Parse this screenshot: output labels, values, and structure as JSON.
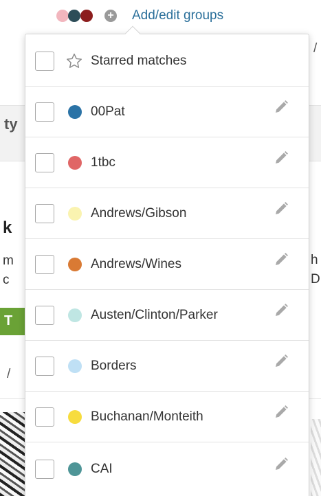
{
  "header": {
    "selected_group_colors": [
      "#f2b6be",
      "#2d4d58",
      "#8c1d1d"
    ],
    "add_icon": "plus-circle-icon",
    "add_edit_label": "Add/edit groups"
  },
  "background": {
    "frag_ty": "ty",
    "frag_k": "k",
    "frag_m": "m",
    "frag_c": "c",
    "frag_h": "h",
    "frag_D": "D",
    "frag_slash": "/",
    "frag_slash2": "/",
    "frag_T": "T"
  },
  "dropdown": {
    "starred": {
      "label": "Starred matches",
      "icon": "star-outline-icon",
      "checked": false
    },
    "groups": [
      {
        "label": "00Pat",
        "color": "#2b73a6",
        "checked": false
      },
      {
        "label": "1tbc",
        "color": "#e06666",
        "checked": false
      },
      {
        "label": "Andrews/Gibson",
        "color": "#faf3b0",
        "checked": false
      },
      {
        "label": "Andrews/Wines",
        "color": "#d97a34",
        "checked": false
      },
      {
        "label": "Austen/Clinton/Parker",
        "color": "#bfe6e3",
        "checked": false
      },
      {
        "label": "Borders",
        "color": "#bfe0f5",
        "checked": false
      },
      {
        "label": "Buchanan/Monteith",
        "color": "#f7dc3e",
        "checked": false
      },
      {
        "label": "CAI",
        "color": "#4e9597",
        "checked": false
      }
    ],
    "edit_icon": "pencil-icon"
  }
}
